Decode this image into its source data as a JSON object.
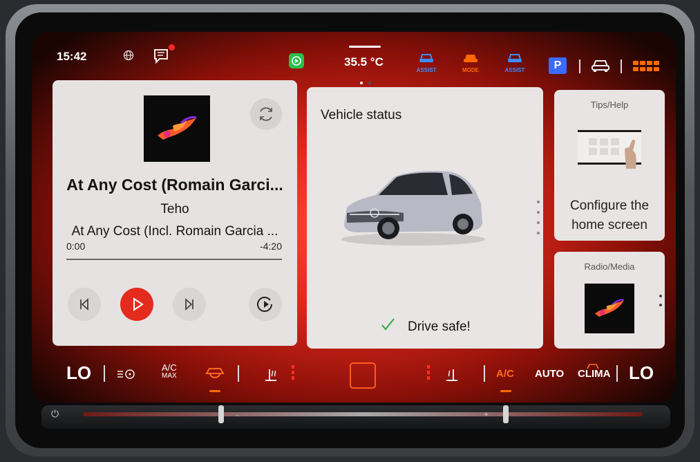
{
  "status_bar": {
    "time": "15:42",
    "temperature": "35.5 °C",
    "assist_label_1": "ASSIST",
    "mode_label": "MODE",
    "assist_label_2": "ASSIST",
    "parking_label": "P",
    "icons": [
      "globe-icon",
      "message-icon",
      "carplay-icon",
      "assist-icon",
      "mode-icon",
      "assist-icon",
      "parking-icon",
      "vehicle-icon",
      "app-grid-icon"
    ],
    "colors": {
      "assist": "#2f8cff",
      "mode": "#ff6a00",
      "parking": "#3a6bff",
      "notification": "#ff2a2a"
    }
  },
  "media_card": {
    "song_title": "At Any Cost (Romain Garci...",
    "artist": "Teho",
    "album": "At Any Cost (Incl. Romain Garcia ...",
    "time_elapsed": "0:00",
    "time_remaining": "-4:20",
    "progress": 0,
    "buttons": [
      "previous",
      "play",
      "next",
      "source"
    ]
  },
  "vehicle_card": {
    "title": "Vehicle status",
    "message": "Drive safe!"
  },
  "tips_card": {
    "title": "Tips/Help",
    "text_line1": "Configure the",
    "text_line2": "home screen"
  },
  "radio_card": {
    "title": "Radio/Media"
  },
  "climate_bar": {
    "left_temp": "LO",
    "ac_max_top": "A/C",
    "ac_max_bottom": "MAX",
    "ac_label": "A/C",
    "auto_label": "AUTO",
    "clima_label": "CLIMA",
    "right_temp": "LO",
    "accent_color": "#ff6a20"
  }
}
